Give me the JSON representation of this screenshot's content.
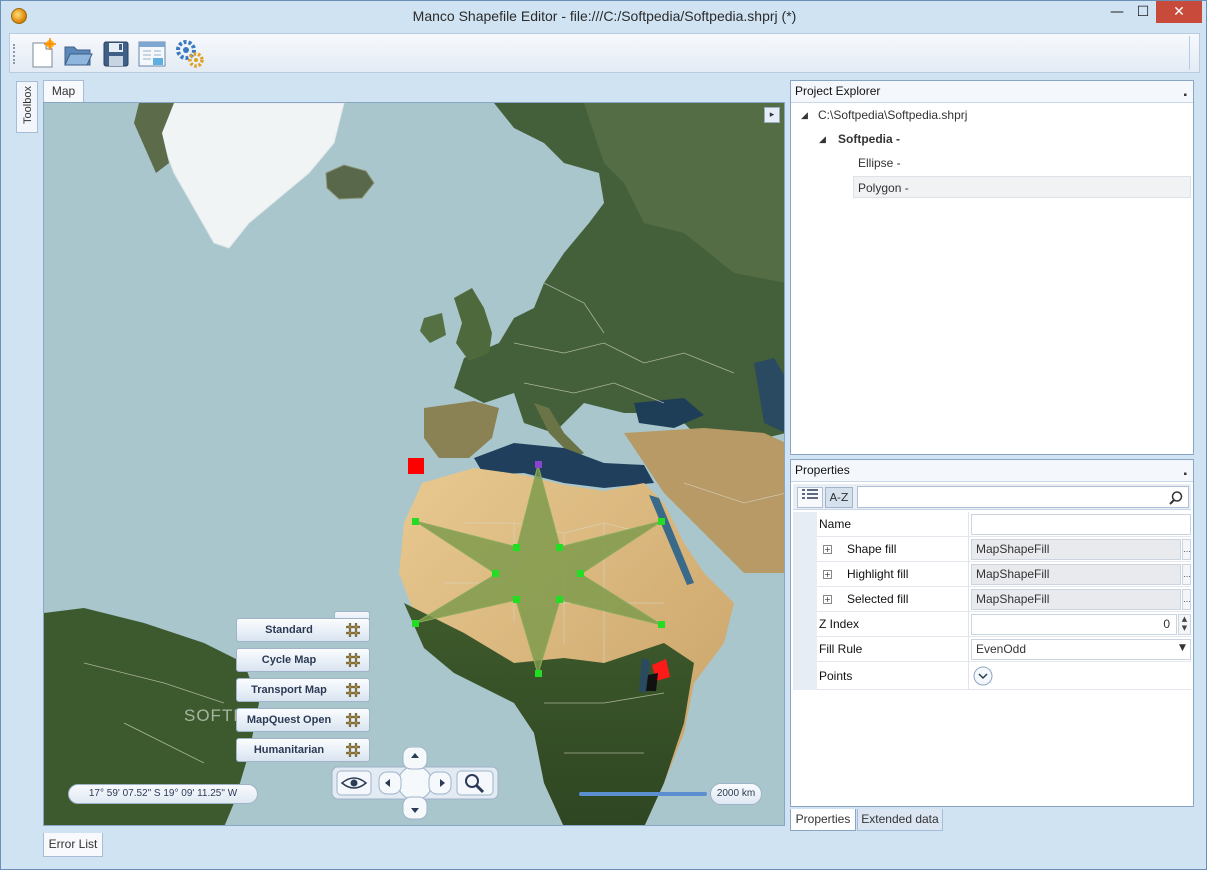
{
  "window": {
    "title": "Manco Shapefile Editor - file:///C:/Softpedia/Softpedia.shprj (*)",
    "min_glyph": "—",
    "max_glyph": "☐",
    "close_glyph": "✕"
  },
  "toolbar": {
    "items": [
      "new-file-icon",
      "open-folder-icon",
      "save-icon",
      "properties-window-icon",
      "settings-gears-icon"
    ]
  },
  "toolbox": {
    "label": "Toolbox"
  },
  "document": {
    "tab_label": "Map",
    "corner_glyph": "▸"
  },
  "map": {
    "watermark": "SOFTPEDIA",
    "layers": [
      "Standard",
      "Cycle Map",
      "Transport Map",
      "MapQuest Open",
      "Humanitarian"
    ],
    "coordinates": "17° 59' 07.52\" S 19° 09' 11.25\" W",
    "scale_label": "2000 km",
    "accent_colors": {
      "polygon_fill": "#7b9a4a",
      "vertex": "#22dd22",
      "marker": "#ff0000",
      "selected_vertex": "#8844cc"
    }
  },
  "bottom": {
    "error_list_label": "Error List"
  },
  "project_explorer": {
    "title": "Project Explorer",
    "pin_glyph": "📌",
    "root": "C:\\Softpedia\\Softpedia.shprj",
    "layer": "Softpedia -",
    "children": [
      "Ellipse -",
      "Polygon -"
    ]
  },
  "properties": {
    "title": "Properties",
    "az_label": "A-Z",
    "rows": [
      {
        "name": "Name",
        "value": "",
        "expandable": false
      },
      {
        "name": "Shape fill",
        "value": "MapShapeFill",
        "expandable": true
      },
      {
        "name": "Highlight fill",
        "value": "MapShapeFill",
        "expandable": true
      },
      {
        "name": "Selected fill",
        "value": "MapShapeFill",
        "expandable": true
      },
      {
        "name": "Z Index",
        "value": "0",
        "expandable": false
      },
      {
        "name": "Fill Rule",
        "value": "EvenOdd",
        "expandable": false
      },
      {
        "name": "Points",
        "value": "",
        "expandable": false
      }
    ],
    "tabs": [
      "Properties",
      "Extended data"
    ]
  }
}
